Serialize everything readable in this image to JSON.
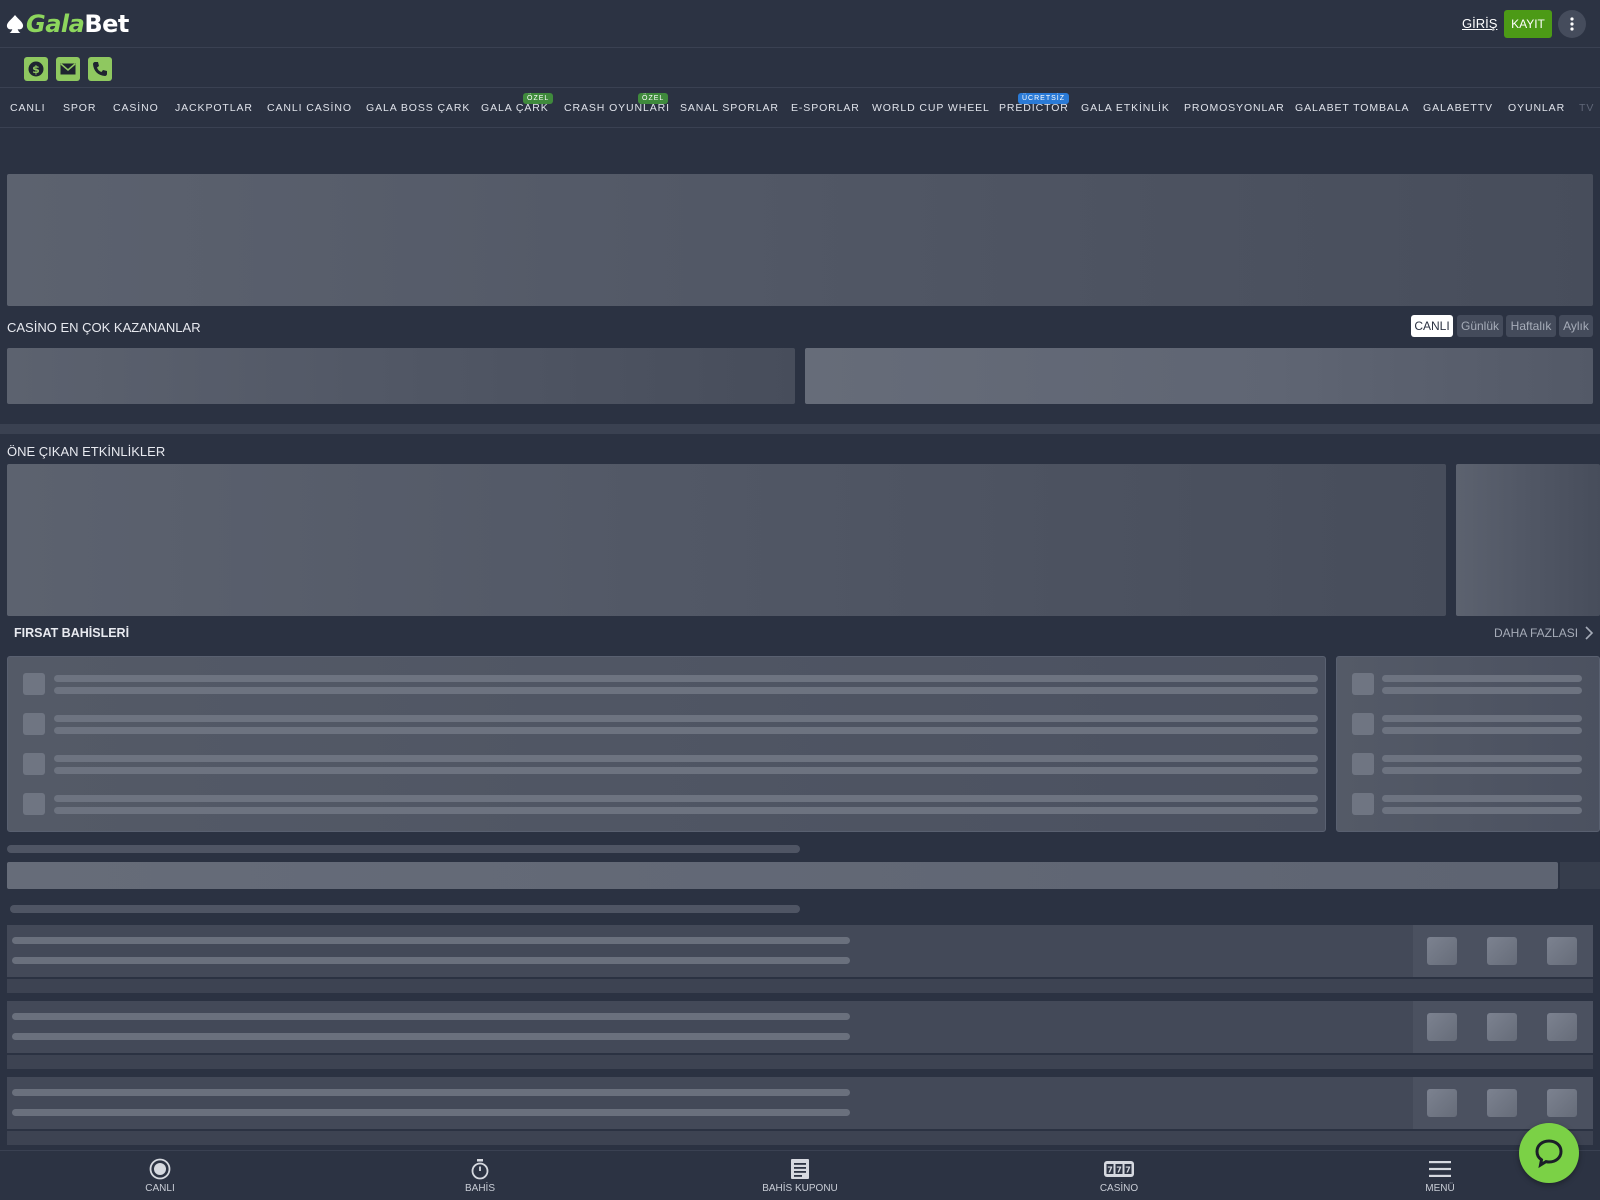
{
  "brand": {
    "logo_part1": "Gala",
    "logo_part2": "Bet"
  },
  "header": {
    "login_label": "GİRİŞ",
    "register_label": "KAYIT"
  },
  "contact": {
    "icons": [
      "dollar-icon",
      "mail-icon",
      "phone-icon"
    ]
  },
  "nav": {
    "items": [
      {
        "label": "CANLI"
      },
      {
        "label": "SPOR"
      },
      {
        "label": "CASİNO"
      },
      {
        "label": "JACKPOTLAR"
      },
      {
        "label": "CANLI CASİNO"
      },
      {
        "label": "GALA BOSS ÇARK"
      },
      {
        "label": "GALA ÇARK",
        "badge": "ÖZEL"
      },
      {
        "label": "CRASH OYUNLARI",
        "badge": "ÖZEL"
      },
      {
        "label": "SANAL SPORLAR"
      },
      {
        "label": "E-SPORLAR"
      },
      {
        "label": "WORLD CUP WHEEL"
      },
      {
        "label": "PREDICTOR",
        "badge": "ÜCRETSİZ"
      },
      {
        "label": "GALA ETKİNLİK"
      },
      {
        "label": "PROMOSYONLAR"
      },
      {
        "label": "GALABET TOMBALA"
      },
      {
        "label": "GALABETTV"
      },
      {
        "label": "OYUNLAR"
      },
      {
        "label": "TV"
      }
    ]
  },
  "casino_winners": {
    "title": "CASİNO EN ÇOK KAZANANLAR",
    "periods": [
      "CANLI",
      "Günlük",
      "Haftalık",
      "Aylık"
    ],
    "active_period": "CANLI"
  },
  "featured": {
    "title": "ÖNE ÇIKAN ETKİNLİKLER"
  },
  "opportunity": {
    "title": "FIRSAT BAHİSLERİ",
    "more_label": "DAHA FAZLASI"
  },
  "bottom_nav": {
    "items": [
      {
        "label": "CANLI",
        "icon": "live-icon"
      },
      {
        "label": "BAHİS",
        "icon": "stopwatch-icon"
      },
      {
        "label": "BAHİS KUPONU",
        "icon": "coupon-icon"
      },
      {
        "label": "CASİNO",
        "icon": "slot-icon"
      },
      {
        "label": "MENÜ",
        "icon": "menu-icon"
      }
    ]
  },
  "colors": {
    "background": "#2b3242",
    "accent_green": "#4c9a16",
    "chat_green": "#7bd146",
    "badge_blue": "#2a7ad6"
  }
}
